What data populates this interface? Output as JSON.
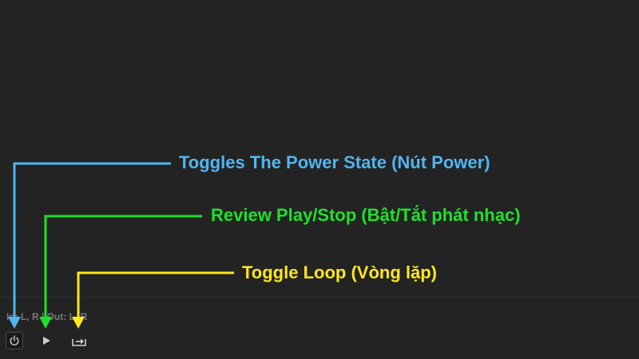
{
  "panel": {
    "io_label": "In: L, R | Out: L, R"
  },
  "controls": {
    "power_icon": "power-icon",
    "play_icon": "play-icon",
    "loop_icon": "loop-icon"
  },
  "annotations": {
    "power": {
      "text": "Toggles The Power State (Nút Power)",
      "color": "#4fb6ef"
    },
    "play": {
      "text": "Review Play/Stop (Bật/Tắt phát nhạc)",
      "color": "#1fe02b"
    },
    "loop": {
      "text": "Toggle Loop (Vòng lặp)",
      "color": "#ffe71a"
    }
  },
  "colors": {
    "background": "#232323",
    "icon": "#cfcfcf",
    "io_text": "#7a7a7a"
  }
}
